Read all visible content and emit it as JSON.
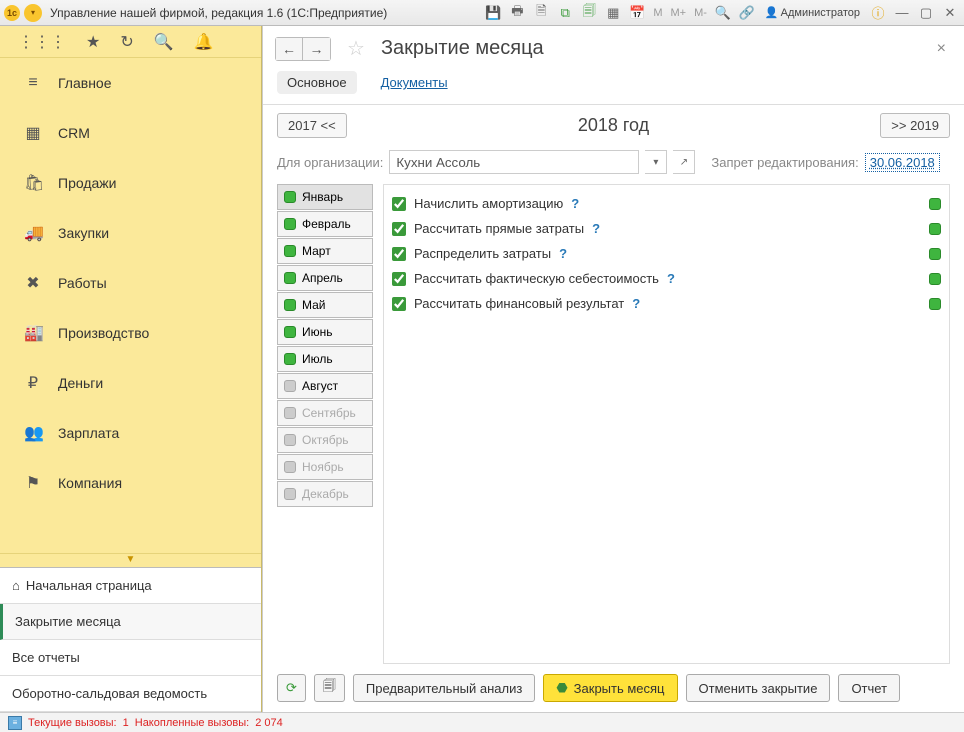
{
  "titlebar": {
    "title": "Управление нашей фирмой, редакция 1.6  (1С:Предприятие)",
    "user": "Администратор"
  },
  "sidebar": {
    "items": [
      {
        "icon": "≡",
        "label": "Главное"
      },
      {
        "icon": "▦",
        "label": "CRM"
      },
      {
        "icon": "🛍",
        "label": "Продажи"
      },
      {
        "icon": "🚚",
        "label": "Закупки"
      },
      {
        "icon": "✖",
        "label": "Работы"
      },
      {
        "icon": "🏭",
        "label": "Производство"
      },
      {
        "icon": "₽",
        "label": "Деньги"
      },
      {
        "icon": "👥",
        "label": "Зарплата"
      },
      {
        "icon": "⚑",
        "label": "Компания"
      }
    ],
    "tabs": [
      {
        "icon": "⌂",
        "label": "Начальная страница",
        "active": false
      },
      {
        "icon": "",
        "label": "Закрытие месяца",
        "active": true
      },
      {
        "icon": "",
        "label": "Все отчеты",
        "active": false
      },
      {
        "icon": "",
        "label": "Оборотно-сальдовая ведомость",
        "active": false
      }
    ]
  },
  "page": {
    "title": "Закрытие месяца",
    "subtabs": {
      "main": "Основное",
      "docs": "Документы"
    },
    "year": {
      "prev": "2017 <<",
      "label": "2018  год",
      "next": ">> 2019"
    },
    "org": {
      "label": "Для организации:",
      "value": "Кухни Ассоль",
      "lock_label": "Запрет редактирования:",
      "lock_date": "30.06.2018"
    },
    "months": [
      {
        "label": "Январь",
        "status": "green",
        "sel": true
      },
      {
        "label": "Февраль",
        "status": "green"
      },
      {
        "label": "Март",
        "status": "green"
      },
      {
        "label": "Апрель",
        "status": "green"
      },
      {
        "label": "Май",
        "status": "green"
      },
      {
        "label": "Июнь",
        "status": "green"
      },
      {
        "label": "Июль",
        "status": "green"
      },
      {
        "label": "Август",
        "status": "grey"
      },
      {
        "label": "Сентябрь",
        "status": "grey",
        "dis": true
      },
      {
        "label": "Октябрь",
        "status": "grey",
        "dis": true
      },
      {
        "label": "Ноябрь",
        "status": "grey",
        "dis": true
      },
      {
        "label": "Декабрь",
        "status": "grey",
        "dis": true
      }
    ],
    "tasks": [
      {
        "label": "Начислить амортизацию"
      },
      {
        "label": "Рассчитать прямые затраты"
      },
      {
        "label": "Распределить затраты"
      },
      {
        "label": "Рассчитать фактическую себестоимость"
      },
      {
        "label": "Рассчитать финансовый результат"
      }
    ],
    "actions": {
      "preview": "Предварительный анализ",
      "close": "Закрыть месяц",
      "cancel": "Отменить закрытие",
      "report": "Отчет"
    }
  },
  "status": {
    "current_label": "Текущие вызовы:",
    "current_val": "1",
    "accum_label": "Накопленные вызовы:",
    "accum_val": "2 074"
  }
}
